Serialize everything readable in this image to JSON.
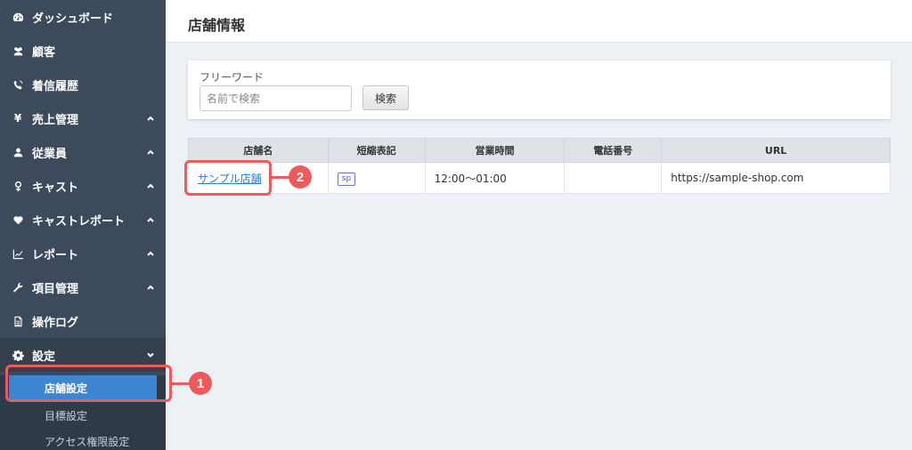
{
  "sidebar": {
    "items": [
      {
        "label": "ダッシュボード",
        "icon": "dashboard-icon",
        "chevron": null
      },
      {
        "label": "顧客",
        "icon": "users-icon",
        "chevron": null
      },
      {
        "label": "着信履歴",
        "icon": "phone-icon",
        "chevron": null
      },
      {
        "label": "売上管理",
        "icon": "yen-icon",
        "chevron": "up"
      },
      {
        "label": "従業員",
        "icon": "user-icon",
        "chevron": "up"
      },
      {
        "label": "キャスト",
        "icon": "female-icon",
        "chevron": "up"
      },
      {
        "label": "キャストレポート",
        "icon": "heart-icon",
        "chevron": "up"
      },
      {
        "label": "レポート",
        "icon": "line-chart-icon",
        "chevron": "up"
      },
      {
        "label": "項目管理",
        "icon": "wrench-icon",
        "chevron": "up"
      },
      {
        "label": "操作ログ",
        "icon": "document-icon",
        "chevron": null
      },
      {
        "label": "設定",
        "icon": "gear-icon",
        "chevron": "down"
      }
    ],
    "settings_sub": [
      "店舗設定",
      "目標設定",
      "アクセス権限設定"
    ]
  },
  "header": {
    "title": "店舗情報"
  },
  "search": {
    "label": "フリーワード",
    "placeholder": "名前で検索",
    "value": "",
    "button": "検索"
  },
  "table": {
    "headers": [
      "店舗名",
      "短縮表記",
      "営業時間",
      "電話番号",
      "URL"
    ],
    "rows": [
      {
        "name": "サンプル店舗",
        "short": "sp",
        "hours": "12:00～01:00",
        "phone": "",
        "url": "https://sample-shop.com"
      }
    ]
  },
  "annotations": {
    "step1": "1",
    "step2": "2"
  },
  "colors": {
    "sidebar": "#3c4a5c",
    "active": "#3d86cf",
    "accent_red": "#ee5a5a",
    "link": "#2a7bd3"
  }
}
